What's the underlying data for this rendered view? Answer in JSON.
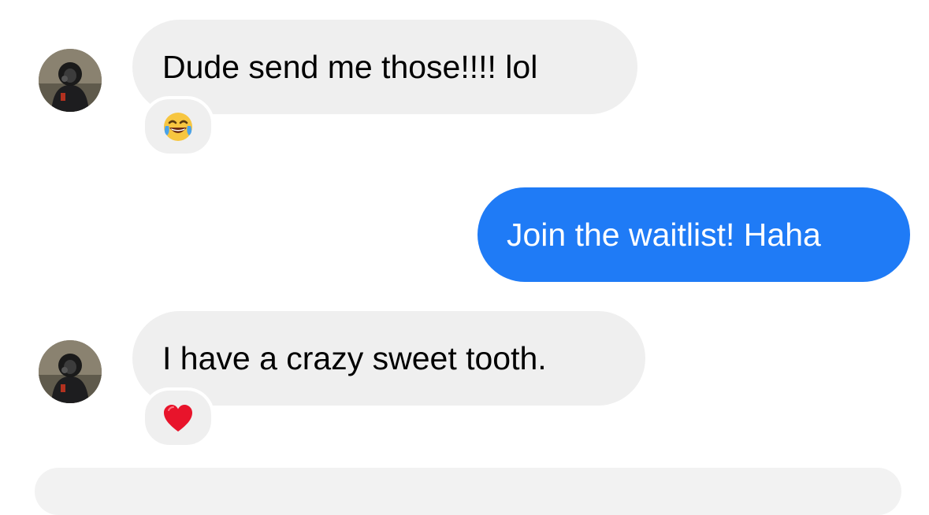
{
  "thread": {
    "messages": [
      {
        "direction": "incoming",
        "text": "Dude send me those!!!! lol",
        "reaction": "face-with-tears-of-joy-emoji"
      },
      {
        "direction": "outgoing",
        "text": "Join the waitlist! Haha"
      },
      {
        "direction": "incoming",
        "text": "I have a crazy sweet tooth.",
        "reaction": "red-heart-emoji"
      }
    ]
  },
  "colors": {
    "incoming_bubble": "#efefef",
    "outgoing_bubble": "#1f7bf6",
    "outgoing_text": "#ffffff",
    "incoming_text": "#000000"
  }
}
